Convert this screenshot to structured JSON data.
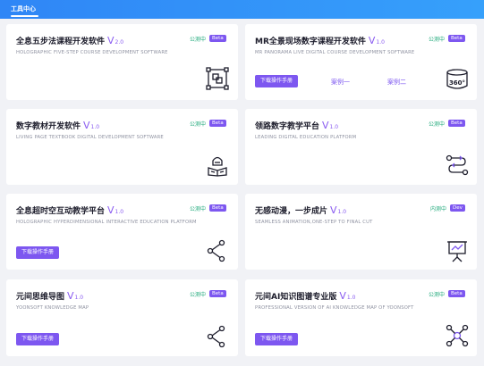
{
  "header": {
    "title": "工具中心"
  },
  "cards": [
    {
      "title": "全息五步法课程开发软件",
      "version_v": "V",
      "version_num": "2.0",
      "subtitle": "HOLOGRAPHIC FIVE-STEP COURSE DEVELOPMENT SOFTWARE",
      "status": "公测中",
      "badge": "Beta",
      "icon": "square-flow-icon"
    },
    {
      "title": "MR全景现场数字课程开发软件",
      "version_v": "V",
      "version_num": "1.0",
      "subtitle": "MR PANORAMA LIVE DIGITAL COURSE DEVELOPMENT SOFTWARE",
      "status": "公测中",
      "badge": "Beta",
      "manual": "下载操作手册",
      "case1": "案例一",
      "case2": "案例二",
      "icon": "panorama-360-icon",
      "icon_text": "360°"
    },
    {
      "title": "数字教材开发软件",
      "version_v": "V",
      "version_num": "1.0",
      "subtitle": "LIVING PAGE TEXTBOOK DIGITAL DEVELOPMENT SOFTWARE",
      "status": "公测中",
      "badge": "Beta",
      "icon": "textbook-icon"
    },
    {
      "title": "领路数字教学平台",
      "version_v": "V",
      "version_num": "1.0",
      "subtitle": "LEADING DIGITAL EDUCATION PLATFORM",
      "status": "公测中",
      "badge": "Beta",
      "icon": "route-icon"
    },
    {
      "title": "全息超时空互动教学平台",
      "version_v": "V",
      "version_num": "1.0",
      "subtitle": "HOLOGRAPHIC HYPERDIMENSIONAL INTERACTIVE EDUCATION PLATFORM",
      "status": "公测中",
      "badge": "Beta",
      "manual": "下载操作手册",
      "icon": "share-nodes-icon"
    },
    {
      "title": "无感动漫，一步成片",
      "version_v": "V",
      "version_num": "1.0",
      "subtitle": "SEAMLESS ANIMATION,ONE-STEP TO FINAL CUT",
      "status": "内测中",
      "badge": "Dev",
      "icon": "presentation-board-icon"
    },
    {
      "title": "元间思维导图",
      "version_v": "V",
      "version_num": "1.0",
      "subtitle": "YOONSOFT KNOWLEDGE MAP",
      "status": "公测中",
      "badge": "Beta",
      "manual": "下载操作手册",
      "icon": "share-nodes-icon"
    },
    {
      "title": "元间AI知识图谱专业版",
      "version_v": "V",
      "version_num": "1.0",
      "subtitle": "PROFESSIONAL VERSION OF AI KNOWLEDGE MAP OF YOONSOFT",
      "status": "公测中",
      "badge": "Beta",
      "manual": "下载操作手册",
      "icon": "network-graph-icon"
    }
  ],
  "colors": {
    "accent": "#7d57f0",
    "status_green": "#1fa97a",
    "header_blue": "#2f86f6",
    "background": "#f1f2f6"
  }
}
